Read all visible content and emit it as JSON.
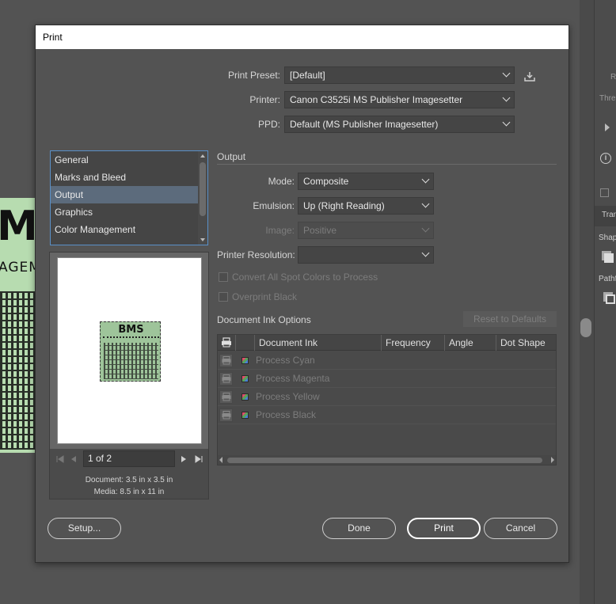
{
  "dialog": {
    "title": "Print"
  },
  "preset": {
    "label": "Print Preset:",
    "value": "[Default]"
  },
  "printer": {
    "label": "Printer:",
    "value": "Canon C3525i MS Publisher Imagesetter"
  },
  "ppd": {
    "label": "PPD:",
    "value": "Default (MS Publisher Imagesetter)"
  },
  "categories": [
    "General",
    "Marks and Bleed",
    "Output",
    "Graphics",
    "Color Management"
  ],
  "selected_category": "Output",
  "preview": {
    "art_title": "BMS",
    "page_indicator": "1 of 2",
    "document_label": "Document:",
    "document_size": "3.5 in x 3.5 in",
    "media_label": "Media:",
    "media_size": "8.5 in x 11 in"
  },
  "output": {
    "section_title": "Output",
    "mode_label": "Mode:",
    "mode_value": "Composite",
    "emulsion_label": "Emulsion:",
    "emulsion_value": "Up (Right Reading)",
    "image_label": "Image:",
    "image_value": "Positive",
    "resolution_label": "Printer Resolution:",
    "resolution_value": "",
    "convert_spot": "Convert All Spot Colors to Process",
    "overprint_black": "Overprint Black"
  },
  "inks": {
    "section_title": "Document Ink Options",
    "reset_label": "Reset to Defaults",
    "columns": [
      "Document Ink",
      "Frequency",
      "Angle",
      "Dot Shape"
    ],
    "rows": [
      "Process Cyan",
      "Process Magenta",
      "Process Yellow",
      "Process Black"
    ]
  },
  "buttons": {
    "setup": "Setup...",
    "done": "Done",
    "print": "Print",
    "cancel": "Cancel"
  },
  "background": {
    "artboard_letter": "M",
    "artboard_text": "AGEM",
    "panel_labels": [
      "R",
      "Thre",
      "Tran",
      "Shap",
      "Pathf"
    ]
  },
  "colors": {
    "dialog_bg": "#535353",
    "selection": "#5c6b7c",
    "list_border": "#5a90c8"
  }
}
